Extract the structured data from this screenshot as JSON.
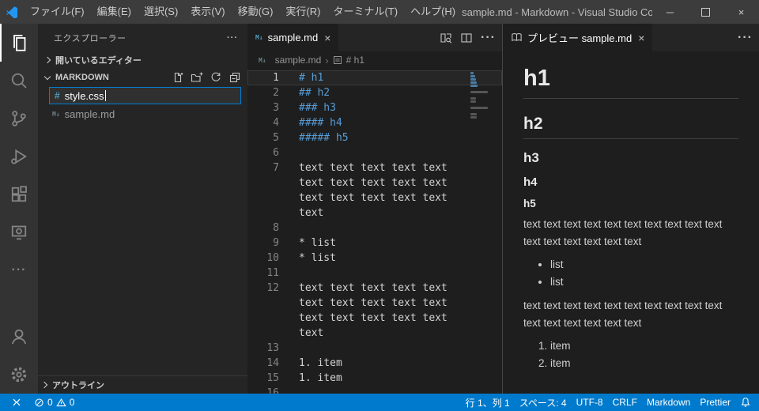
{
  "title_bar": {
    "menus": [
      "ファイル(F)",
      "編集(E)",
      "選択(S)",
      "表示(V)",
      "移動(G)",
      "実行(R)",
      "ターミナル(T)",
      "ヘルプ(H)"
    ],
    "title": "sample.md - Markdown - Visual Studio Code",
    "window_controls": {
      "minimize": "─",
      "close": "×"
    }
  },
  "activity_bar": {
    "icons": [
      "explorer-icon",
      "search-icon",
      "source-control-icon",
      "run-debug-icon",
      "extensions-icon",
      "remote-explorer-icon",
      "more-icon",
      "account-icon",
      "settings-gear-icon"
    ]
  },
  "sidebar": {
    "title": "エクスプローラー",
    "more": "···",
    "open_editors_label": "開いているエディター",
    "workspace_label": "MARKDOWN",
    "workspace_actions": [
      "new-file-icon",
      "new-folder-icon",
      "refresh-icon",
      "collapse-all-icon"
    ],
    "new_file_input": {
      "value": "style.css",
      "icon": "css-hash-icon",
      "icon_glyph": "#"
    },
    "files": [
      {
        "badge": "M↓",
        "name": "sample.md"
      }
    ],
    "outline_label": "アウトライン"
  },
  "editor": {
    "tab": {
      "badge": "M↓",
      "label": "sample.md",
      "close": "×"
    },
    "actions": [
      "open-preview-icon",
      "split-editor-icon",
      "more-actions-icon"
    ],
    "breadcrumb": {
      "file": "sample.md",
      "separator": "›",
      "symbol": "# h1"
    },
    "lines": [
      {
        "n": "1",
        "t": "# h1",
        "c": "tok-heading",
        "row": "current-line"
      },
      {
        "n": "2",
        "t": "## h2",
        "c": "tok-heading"
      },
      {
        "n": "3",
        "t": "### h3",
        "c": "tok-heading"
      },
      {
        "n": "4",
        "t": "#### h4",
        "c": "tok-heading"
      },
      {
        "n": "5",
        "t": "##### h5",
        "c": "tok-heading"
      },
      {
        "n": "6",
        "t": ""
      },
      {
        "n": "7",
        "t": "text text text text text text text text text text text text text text text text"
      },
      {
        "n": "8",
        "t": ""
      },
      {
        "n": "9",
        "t": "* list"
      },
      {
        "n": "10",
        "t": "* list"
      },
      {
        "n": "11",
        "t": ""
      },
      {
        "n": "12",
        "t": "text text text text text text text text text text text text text text text text"
      },
      {
        "n": "13",
        "t": ""
      },
      {
        "n": "14",
        "t": "1. item"
      },
      {
        "n": "15",
        "t": "1. item"
      },
      {
        "n": "16",
        "t": ""
      }
    ]
  },
  "preview": {
    "tab": {
      "icon": "preview-icon",
      "label": "プレビュー sample.md",
      "close": "×"
    },
    "more": "···",
    "blocks": [
      {
        "type": "h1",
        "text": "h1"
      },
      {
        "type": "h2",
        "text": "h2"
      },
      {
        "type": "h3",
        "text": "h3"
      },
      {
        "type": "h4",
        "text": "h4"
      },
      {
        "type": "h5",
        "text": "h5"
      },
      {
        "type": "p",
        "text": "text text text text text text text text text text text text text text text text"
      },
      {
        "type": "ul",
        "items": [
          "list",
          "list"
        ]
      },
      {
        "type": "p",
        "text": "text text text text text text text text text text text text text text text text"
      },
      {
        "type": "ol",
        "items": [
          "item",
          "item"
        ]
      }
    ]
  },
  "status_bar": {
    "remote_icon": "remote-icon",
    "errors": "0",
    "warnings": "0",
    "items": [
      "行 1、列 1",
      "スペース: 4",
      "UTF-8",
      "CRLF",
      "Markdown",
      "Prettier"
    ],
    "bell_icon": "bell-icon"
  }
}
